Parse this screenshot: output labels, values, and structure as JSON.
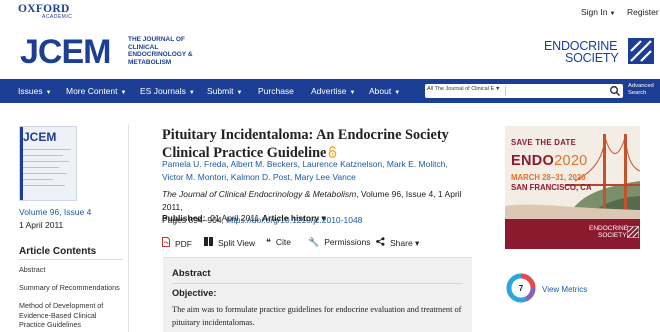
{
  "publisher": {
    "name": "OXFORD",
    "sub": "ACADEMIC"
  },
  "account": {
    "sign_in": "Sign In",
    "register": "Register"
  },
  "journal": {
    "logo": "JCEM",
    "subtitle": "THE JOURNAL OF CLINICAL ENDOCRINOLOGY & METABOLISM",
    "partner_line1": "ENDOCRINE",
    "partner_line2": "SOCIETY"
  },
  "nav": {
    "items": [
      {
        "label": "Issues",
        "dropdown": true
      },
      {
        "label": "More Content",
        "dropdown": true
      },
      {
        "label": "ES Journals",
        "dropdown": true
      },
      {
        "label": "Submit",
        "dropdown": true
      },
      {
        "label": "Purchase",
        "dropdown": false
      },
      {
        "label": "Advertise",
        "dropdown": true
      },
      {
        "label": "About",
        "dropdown": true
      }
    ],
    "search_scope": "All The Journal of Clinical E",
    "search_placeholder": "",
    "advanced_line1": "Advanced",
    "advanced_line2": "Search"
  },
  "sidebar": {
    "cover_title": "JCEM",
    "volume": "Volume 96, Issue 4",
    "date": "1 April 2011",
    "contents_title": "Article Contents",
    "contents": [
      "Abstract",
      "Summary of Recommendations",
      "Method of Development of Evidence-Based Clinical Practice Guidelines"
    ]
  },
  "article": {
    "title": "Pituitary Incidentaloma: An Endocrine Society Clinical Practice Guideline",
    "authors_line1": "Pamela U. Freda, Albert M. Beckers, Laurence Katznelson, Mark E. Molitch,",
    "authors_line2": "Victor M. Montori, Kalmon D. Post, Mary Lee Vance",
    "journal_name": "The Journal of Clinical Endocrinology & Metabolism",
    "citation_rest": ", Volume 96, Issue 4, 1 April 2011,",
    "pages": "Pages 894–904,",
    "doi": "https://doi.org/10.1210/jc.2010-1048",
    "published_label": "Published:",
    "published_date": "01 April 2011",
    "history": "Article history ▾",
    "tools": {
      "pdf": "PDF",
      "split": "Split View",
      "cite": "Cite",
      "permissions": "Permissions",
      "share": "Share ▾"
    },
    "abstract_title": "Abstract",
    "objective_label": "Objective:",
    "objective_text": "The aim was to formulate practice guidelines for endocrine evaluation and treatment of pituitary incidentalomas."
  },
  "ad": {
    "save": "SAVE THE DATE",
    "endo": "ENDO",
    "year": "2020",
    "dates": "MARCH 28–31, 2020",
    "city": "SAN FRANCISCO, CA",
    "es_line1": "ENDOCRINE",
    "es_line2": "SOCIETY"
  },
  "metrics": {
    "score": "7",
    "link": "View Metrics"
  },
  "colors": {
    "brand": "#1c3f95",
    "link": "#1c5aa8",
    "ad_maroon": "#8b1a2e",
    "ad_orange": "#e0702a",
    "oa": "#f5a623"
  }
}
